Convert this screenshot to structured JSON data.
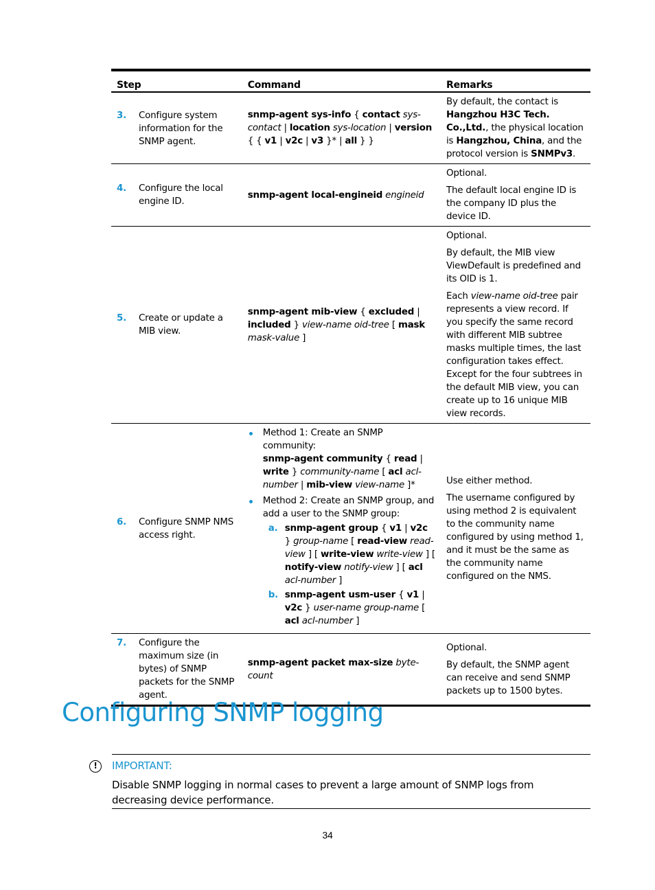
{
  "table": {
    "headers": {
      "step": "Step",
      "command": "Command",
      "remarks": "Remarks"
    },
    "rows": [
      {
        "num": "3.",
        "step": "Configure system information for the SNMP agent.",
        "command": [
          {
            "t": "snmp-agent sys-info",
            "s": "b"
          },
          {
            "t": " { ",
            "s": ""
          },
          {
            "t": "contact",
            "s": "b"
          },
          {
            "t": " sys-contact",
            "s": "i"
          },
          {
            "t": " | ",
            "s": ""
          },
          {
            "t": "location",
            "s": "b"
          },
          {
            "t": " sys-location",
            "s": "i"
          },
          {
            "t": " | ",
            "s": ""
          },
          {
            "t": "version",
            "s": "b"
          },
          {
            "t": " { { ",
            "s": ""
          },
          {
            "t": "v1",
            "s": "b"
          },
          {
            "t": " | ",
            "s": ""
          },
          {
            "t": "v2c",
            "s": "b"
          },
          {
            "t": " | ",
            "s": ""
          },
          {
            "t": "v3",
            "s": "b"
          },
          {
            "t": " }* | ",
            "s": ""
          },
          {
            "t": "all",
            "s": "b"
          },
          {
            "t": " } }",
            "s": ""
          }
        ],
        "remarks": [
          [
            {
              "t": "By default, the contact is ",
              "s": ""
            },
            {
              "t": "Hangzhou H3C Tech. Co.,Ltd.",
              "s": "b"
            },
            {
              "t": ", the physical location is ",
              "s": ""
            },
            {
              "t": "Hangzhou, China",
              "s": "b"
            },
            {
              "t": ", and the protocol version is ",
              "s": ""
            },
            {
              "t": "SNMPv3",
              "s": "b"
            },
            {
              "t": ".",
              "s": ""
            }
          ]
        ]
      },
      {
        "num": "4.",
        "step": "Configure the local engine ID.",
        "command": [
          {
            "t": "snmp-agent local-engineid",
            "s": "b"
          },
          {
            "t": " engineid",
            "s": "i"
          }
        ],
        "remarks": [
          [
            {
              "t": "Optional.",
              "s": ""
            }
          ],
          [
            {
              "t": "The default local engine ID is the company ID plus the device ID.",
              "s": ""
            }
          ]
        ]
      },
      {
        "num": "5.",
        "step": "Create or update a MIB view.",
        "command": [
          {
            "t": "snmp-agent mib-view",
            "s": "b"
          },
          {
            "t": " { ",
            "s": ""
          },
          {
            "t": "excluded",
            "s": "b"
          },
          {
            "t": " | ",
            "s": ""
          },
          {
            "t": "included",
            "s": "b"
          },
          {
            "t": " } ",
            "s": ""
          },
          {
            "t": "view-name oid-tree",
            "s": "i"
          },
          {
            "t": " [ ",
            "s": ""
          },
          {
            "t": "mask",
            "s": "b"
          },
          {
            "t": " mask-value",
            "s": "i"
          },
          {
            "t": " ]",
            "s": ""
          }
        ],
        "remarks": [
          [
            {
              "t": "Optional.",
              "s": ""
            }
          ],
          [
            {
              "t": "By default, the MIB view ViewDefault is predefined and its OID is 1.",
              "s": ""
            }
          ],
          [
            {
              "t": "Each ",
              "s": ""
            },
            {
              "t": "view-name oid-tree",
              "s": "i"
            },
            {
              "t": " pair represents a view record. If you specify the same record with different MIB subtree masks multiple times, the last configuration takes effect. Except for the four subtrees in the default MIB view, you can create up to 16 unique MIB view records.",
              "s": ""
            }
          ]
        ]
      },
      {
        "num": "6.",
        "step": "Configure SNMP NMS access right.",
        "methods": [
          {
            "intro": "Method 1: Create an SNMP community:",
            "command": [
              {
                "t": "snmp-agent community",
                "s": "b"
              },
              {
                "t": " { ",
                "s": ""
              },
              {
                "t": "read",
                "s": "b"
              },
              {
                "t": " | ",
                "s": ""
              },
              {
                "t": "write",
                "s": "b"
              },
              {
                "t": " } ",
                "s": ""
              },
              {
                "t": "community-name",
                "s": "i"
              },
              {
                "t": " [ ",
                "s": ""
              },
              {
                "t": "acl",
                "s": "b"
              },
              {
                "t": " acl-number",
                "s": "i"
              },
              {
                "t": " | ",
                "s": ""
              },
              {
                "t": "mib-view",
                "s": "b"
              },
              {
                "t": " view-name",
                "s": "i"
              },
              {
                "t": " ]*",
                "s": ""
              }
            ],
            "sub": []
          },
          {
            "intro": "Method 2: Create an SNMP group, and add a user to the SNMP group:",
            "command": [],
            "sub": [
              {
                "label": "a.",
                "command": [
                  {
                    "t": "snmp-agent group",
                    "s": "b"
                  },
                  {
                    "t": " { ",
                    "s": ""
                  },
                  {
                    "t": "v1",
                    "s": "b"
                  },
                  {
                    "t": " | ",
                    "s": ""
                  },
                  {
                    "t": "v2c",
                    "s": "b"
                  },
                  {
                    "t": " } ",
                    "s": ""
                  },
                  {
                    "t": "group-name",
                    "s": "i"
                  },
                  {
                    "t": " [ ",
                    "s": ""
                  },
                  {
                    "t": "read-view",
                    "s": "b"
                  },
                  {
                    "t": " read-view",
                    "s": "i"
                  },
                  {
                    "t": " ] [ ",
                    "s": ""
                  },
                  {
                    "t": "write-view",
                    "s": "b"
                  },
                  {
                    "t": " write-view",
                    "s": "i"
                  },
                  {
                    "t": " ] [ ",
                    "s": ""
                  },
                  {
                    "t": "notify-view",
                    "s": "b"
                  },
                  {
                    "t": " notify-view",
                    "s": "i"
                  },
                  {
                    "t": " ] [ ",
                    "s": ""
                  },
                  {
                    "t": "acl",
                    "s": "b"
                  },
                  {
                    "t": " acl-number",
                    "s": "i"
                  },
                  {
                    "t": " ]",
                    "s": ""
                  }
                ]
              },
              {
                "label": "b.",
                "command": [
                  {
                    "t": "snmp-agent usm-user",
                    "s": "b"
                  },
                  {
                    "t": " { ",
                    "s": ""
                  },
                  {
                    "t": "v1",
                    "s": "b"
                  },
                  {
                    "t": " | ",
                    "s": ""
                  },
                  {
                    "t": "v2c",
                    "s": "b"
                  },
                  {
                    "t": " } ",
                    "s": ""
                  },
                  {
                    "t": "user-name group-name",
                    "s": "i"
                  },
                  {
                    "t": " [ ",
                    "s": ""
                  },
                  {
                    "t": "acl",
                    "s": "b"
                  },
                  {
                    "t": " acl-number",
                    "s": "i"
                  },
                  {
                    "t": " ]",
                    "s": ""
                  }
                ]
              }
            ]
          }
        ],
        "remarks": [
          [
            {
              "t": "Use either method.",
              "s": ""
            }
          ],
          [
            {
              "t": "The username configured by using method 2 is equivalent to the community name configured by using method 1, and it must be the same as the community name configured on the NMS.",
              "s": ""
            }
          ]
        ]
      },
      {
        "num": "7.",
        "step": "Configure the maximum size (in bytes) of SNMP packets for the SNMP agent.",
        "command": [
          {
            "t": "snmp-agent packet max-size",
            "s": "b"
          },
          {
            "t": " byte-count",
            "s": "i"
          }
        ],
        "remarks": [
          [
            {
              "t": "Optional.",
              "s": ""
            }
          ],
          [
            {
              "t": "By default, the SNMP agent can receive and send SNMP packets up to 1500 bytes.",
              "s": ""
            }
          ]
        ]
      }
    ]
  },
  "section": {
    "title": "Configuring SNMP logging"
  },
  "important": {
    "icon": "exclamation-circle-icon",
    "title": "IMPORTANT:",
    "body": "Disable SNMP logging in normal cases to prevent a large amount of SNMP logs from decreasing device performance."
  },
  "page_number": "34",
  "colors": {
    "accent": "#1a95d0",
    "text": "#000000"
  }
}
